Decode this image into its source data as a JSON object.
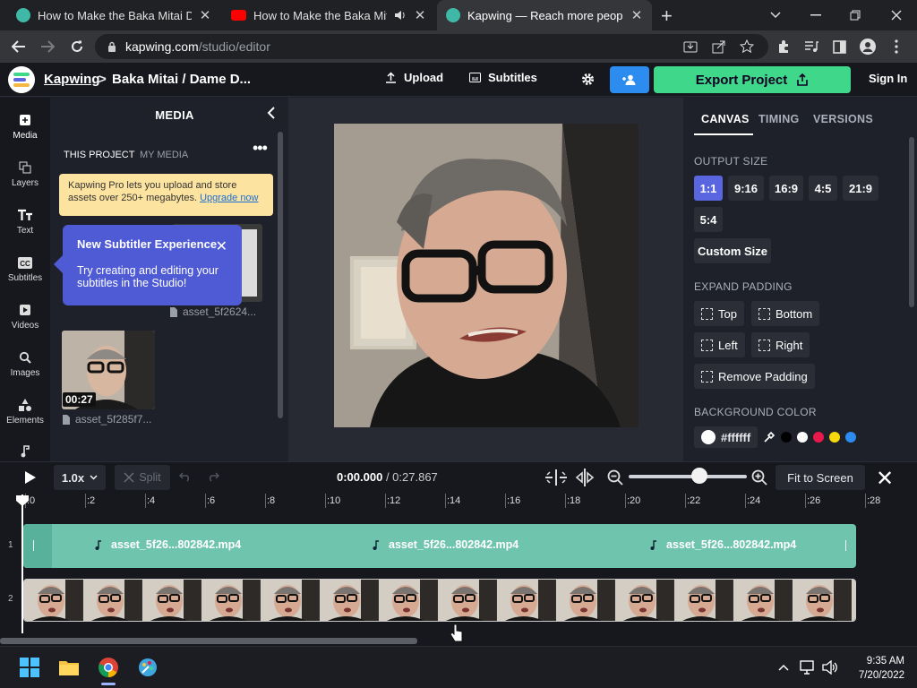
{
  "browser": {
    "tabs": [
      {
        "title": "How to Make the Baka Mitai Dan",
        "close": "✕"
      },
      {
        "title": "How to Make the Baka Mitai",
        "close": "✕"
      },
      {
        "title": "Kapwing — Reach more people w",
        "close": "✕"
      }
    ],
    "new_tab": "+",
    "url_host": "kapwing.com",
    "url_path": "/studio/editor"
  },
  "header": {
    "brand": "Kapwing",
    "separator": ">",
    "project": "Baka Mitai / Dame D...",
    "upload": "Upload",
    "subtitles": "Subtitles",
    "export": "Export Project",
    "signin": "Sign In"
  },
  "rail": [
    {
      "label": "Media",
      "icon": "media-icon"
    },
    {
      "label": "Layers",
      "icon": "layers-icon"
    },
    {
      "label": "Text",
      "icon": "text-icon"
    },
    {
      "label": "Subtitles",
      "icon": "subtitles-icon"
    },
    {
      "label": "Videos",
      "icon": "videos-icon"
    },
    {
      "label": "Images",
      "icon": "images-icon"
    },
    {
      "label": "Elements",
      "icon": "elements-icon"
    }
  ],
  "media": {
    "title": "MEDIA",
    "tab_project": "THIS PROJECT",
    "tab_my": "MY MEDIA",
    "banner_text": "Kapwing Pro lets you upload and store assets over 250+ megabytes.",
    "banner_link": "Upgrade now",
    "tip_title": "New Subtitler Experience",
    "tip_body": "Try creating and editing your subtitles in the Studio!",
    "asset1": "asset_5f2624...",
    "asset2": "asset_5f285f7...",
    "duration": "00:27"
  },
  "canvas_panel": {
    "tabs": [
      "CANVAS",
      "TIMING",
      "VERSIONS"
    ],
    "output_size_label": "OUTPUT SIZE",
    "sizes": [
      "1:1",
      "9:16",
      "16:9",
      "4:5",
      "21:9",
      "5:4"
    ],
    "selected_size": "1:1",
    "custom_size": "Custom Size",
    "expand_padding_label": "EXPAND PADDING",
    "padding": {
      "top": "Top",
      "bottom": "Bottom",
      "left": "Left",
      "right": "Right",
      "remove": "Remove Padding"
    },
    "background_label": "BACKGROUND COLOR",
    "background_value": "#ffffff",
    "swatches": [
      "#000000",
      "#ffffff",
      "#e8194b",
      "#f5d90a",
      "#2d8cf0"
    ]
  },
  "timeline": {
    "speed": "1.0x",
    "split": "Split",
    "current_time": "0:00.000",
    "total_time": "/ 0:27.867",
    "zoom_level": 0.6,
    "fit": "Fit to Screen",
    "ticks": [
      ":0",
      ":2",
      ":4",
      ":6",
      ":8",
      ":10",
      ":12",
      ":14",
      ":16",
      ":18",
      ":20",
      ":22",
      ":24",
      ":26",
      ":28"
    ],
    "track1_num": "1",
    "track2_num": "2",
    "audio_clips": [
      "asset_5f26...802842.mp4",
      "asset_5f26...802842.mp4",
      "asset_5f26...802842.mp4"
    ]
  },
  "taskbar": {
    "time": "9:35 AM",
    "date": "7/20/2022"
  }
}
